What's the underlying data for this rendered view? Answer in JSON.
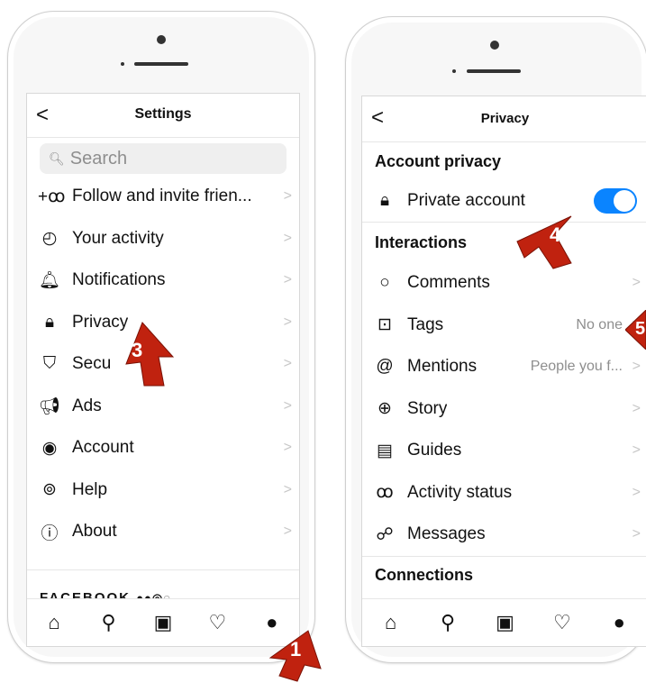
{
  "left": {
    "header": {
      "back": "<",
      "title": "Settings"
    },
    "search": {
      "icon": "search-icon",
      "placeholder": "Search"
    },
    "items": [
      {
        "icon": "follow-icon",
        "glyph": "+ꝏ",
        "label": "Follow and invite frien..."
      },
      {
        "icon": "activity-icon",
        "glyph": "◴",
        "label": "Your activity"
      },
      {
        "icon": "bell-icon",
        "glyph": "🔔︎",
        "label": "Notifications"
      },
      {
        "icon": "lock-icon",
        "glyph": "🔒︎",
        "label": "Privacy"
      },
      {
        "icon": "shield-icon",
        "glyph": "⛉",
        "label": "Secu"
      },
      {
        "icon": "megaphone-icon",
        "glyph": "📢︎",
        "label": "Ads"
      },
      {
        "icon": "account-icon",
        "glyph": "◉",
        "label": "Account"
      },
      {
        "icon": "help-icon",
        "glyph": "⊚",
        "label": "Help"
      },
      {
        "icon": "info-icon",
        "glyph": "ⓘ",
        "label": "About"
      }
    ],
    "chevron": ">",
    "facebook": "FACEBOOK",
    "facebook_icons": "●●◎◌▬",
    "tabs": [
      {
        "icon": "home-icon",
        "glyph": "⌂"
      },
      {
        "icon": "search-icon",
        "glyph": "⚲"
      },
      {
        "icon": "reels-icon",
        "glyph": "▣"
      },
      {
        "icon": "heart-icon",
        "glyph": "♡"
      },
      {
        "icon": "profile-icon",
        "glyph": "●"
      }
    ]
  },
  "right": {
    "header": {
      "back": "<",
      "title": "Privacy"
    },
    "sections": {
      "account_privacy": "Account privacy",
      "interactions": "Interactions",
      "connections": "Connections"
    },
    "private_account": {
      "icon": "lock-icon",
      "glyph": "🔒︎",
      "label": "Private account",
      "enabled": true
    },
    "items": [
      {
        "icon": "comment-icon",
        "glyph": "○",
        "label": "Comments",
        "value": ""
      },
      {
        "icon": "tag-icon",
        "glyph": "⊡",
        "label": "Tags",
        "value": "No one"
      },
      {
        "icon": "mention-icon",
        "glyph": "@",
        "label": "Mentions",
        "value": "People you f..."
      },
      {
        "icon": "story-icon",
        "glyph": "⊕",
        "label": "Story",
        "value": ""
      },
      {
        "icon": "guides-icon",
        "glyph": "▤",
        "label": "Guides",
        "value": ""
      },
      {
        "icon": "activity-status-icon",
        "glyph": "ꝏ",
        "label": "Activity status",
        "value": ""
      },
      {
        "icon": "messenger-icon",
        "glyph": "☍",
        "label": "Messages",
        "value": ""
      }
    ],
    "chevron": ">",
    "tabs": [
      {
        "icon": "home-icon",
        "glyph": "⌂"
      },
      {
        "icon": "search-icon",
        "glyph": "⚲"
      },
      {
        "icon": "reels-icon",
        "glyph": "▣"
      },
      {
        "icon": "heart-icon",
        "glyph": "♡"
      },
      {
        "icon": "profile-icon",
        "glyph": "●"
      }
    ]
  },
  "annotations": {
    "step1": "1",
    "step3": "3",
    "step4": "4",
    "step5": "5",
    "color": "#c0220f"
  }
}
